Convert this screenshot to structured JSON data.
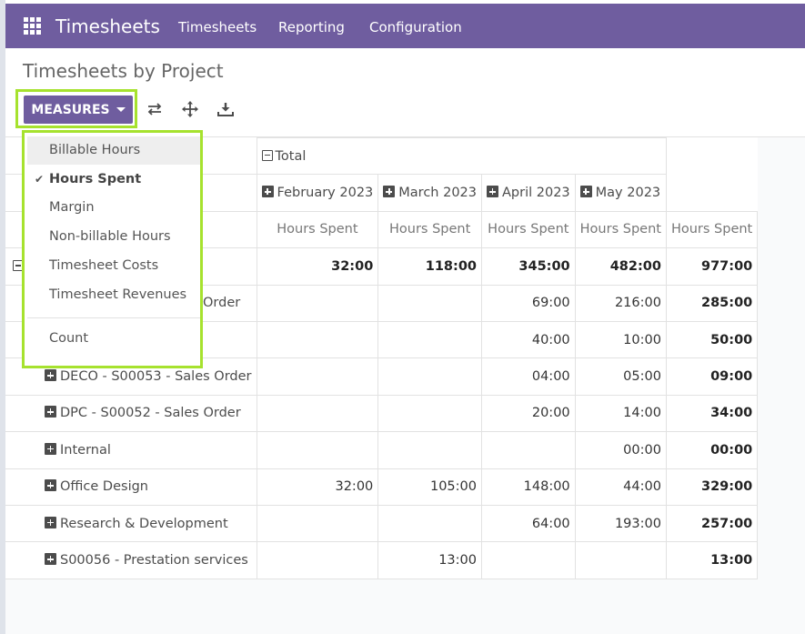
{
  "navbar": {
    "brand": "Timesheets",
    "items": [
      "Timesheets",
      "Reporting",
      "Configuration"
    ]
  },
  "page": {
    "title": "Timesheets by Project"
  },
  "toolbar": {
    "measures_label": "MEASURES"
  },
  "icons": {
    "apps": "apps-grid-icon",
    "flip": "flip-axis-icon",
    "expand": "expand-all-icon",
    "download": "download-icon"
  },
  "colors": {
    "primary": "#6f5d9f",
    "highlight": "#a6e22e"
  },
  "dropdown": {
    "items": [
      "Billable Hours",
      "Hours Spent",
      "Margin",
      "Non-billable Hours",
      "Timesheet Costs",
      "Timesheet Revenues"
    ],
    "selected": "Hours Spent",
    "count_label": "Count"
  },
  "pivot": {
    "total_header": "Total",
    "columns": [
      "February 2023",
      "March 2023",
      "April 2023",
      "May 2023"
    ],
    "measure_label": "Hours Spent",
    "rows": [
      {
        "label": "",
        "values": [
          "32:00",
          "118:00",
          "345:00",
          "482:00"
        ],
        "total": "977:00"
      },
      {
        "label": "Order",
        "values": [
          "",
          "",
          "69:00",
          "216:00"
        ],
        "total": "285:00"
      },
      {
        "label": "",
        "values": [
          "",
          "",
          "40:00",
          "10:00"
        ],
        "total": "50:00"
      },
      {
        "label": "DECO - S00053 - Sales Order",
        "values": [
          "",
          "",
          "04:00",
          "05:00"
        ],
        "total": "09:00"
      },
      {
        "label": "DPC - S00052 - Sales Order",
        "values": [
          "",
          "",
          "20:00",
          "14:00"
        ],
        "total": "34:00"
      },
      {
        "label": "Internal",
        "values": [
          "",
          "",
          "",
          "00:00"
        ],
        "total": "00:00"
      },
      {
        "label": "Office Design",
        "values": [
          "32:00",
          "105:00",
          "148:00",
          "44:00"
        ],
        "total": "329:00"
      },
      {
        "label": "Research & Development",
        "values": [
          "",
          "",
          "64:00",
          "193:00"
        ],
        "total": "257:00"
      },
      {
        "label": "S00056 - Prestation services",
        "values": [
          "",
          "13:00",
          "",
          ""
        ],
        "total": "13:00"
      }
    ]
  }
}
